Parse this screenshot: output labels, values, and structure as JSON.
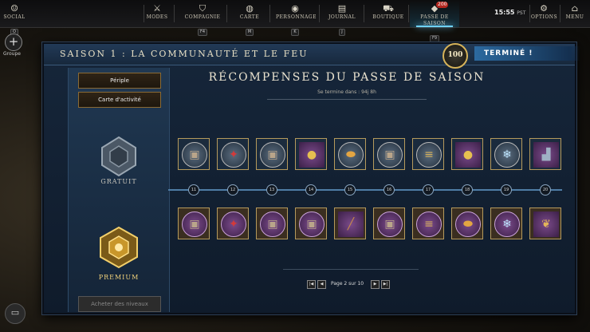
{
  "topbar": {
    "left": {
      "label": "SOCIAL",
      "key": "O",
      "icon": "people-icon"
    },
    "items": [
      {
        "id": "modes",
        "label": "MODES",
        "key": "",
        "icon": "crossed-swords-icon"
      },
      {
        "id": "company",
        "label": "COMPAGNIE",
        "key": "F4",
        "icon": "shield-icon"
      },
      {
        "id": "map",
        "label": "CARTE",
        "key": "M",
        "icon": "globe-icon"
      },
      {
        "id": "character",
        "label": "PERSONNAGE",
        "key": "K",
        "icon": "person-icon"
      },
      {
        "id": "journal",
        "label": "JOURNAL",
        "key": "J",
        "icon": "book-icon"
      },
      {
        "id": "store",
        "label": "BOUTIQUE",
        "key": "",
        "icon": "cart-icon"
      },
      {
        "id": "season",
        "label": "PASSE DE SAISON",
        "key": "F9",
        "icon": "diamond-icon",
        "badge": "200"
      }
    ],
    "clock": "15:55",
    "clock_zone": "PST",
    "options_label": "OPTIONS",
    "menu_label": "MENU"
  },
  "sidebar": {
    "group_label": "Groupe"
  },
  "panel": {
    "title": "SAISON 1 : LA COMMUNAUTÉ ET LE FEU",
    "level": "100",
    "status": "TERMINÉ !",
    "left": {
      "btn_journey": "Périple",
      "btn_activity": "Carte d'activité",
      "free_label": "GRATUIT",
      "premium_label": "PREMIUM",
      "buy_levels": "Acheter des niveaux"
    },
    "rewards_title": "RÉCOMPENSES DU PASSE DE SAISON",
    "ends_in": "Se termine dans : 94j 8h",
    "levels": [
      "11",
      "12",
      "13",
      "14",
      "15",
      "16",
      "17",
      "18",
      "19",
      "20"
    ],
    "free_rewards": [
      {
        "icon": "chest-icon",
        "frame": "orb"
      },
      {
        "icon": "red-gems-icon",
        "frame": "orb"
      },
      {
        "icon": "chest-icon",
        "frame": "orb"
      },
      {
        "icon": "gold-coin-icon",
        "frame": "square"
      },
      {
        "icon": "gold-coins-pile-icon",
        "frame": "orb"
      },
      {
        "icon": "chest-icon",
        "frame": "orb"
      },
      {
        "icon": "coin-stacks-icon",
        "frame": "orb"
      },
      {
        "icon": "gold-coin-icon",
        "frame": "square"
      },
      {
        "icon": "ice-crystals-icon",
        "frame": "orb"
      },
      {
        "icon": "boots-icon",
        "frame": "square"
      }
    ],
    "premium_rewards": [
      {
        "icon": "chest-icon",
        "frame": "orb"
      },
      {
        "icon": "red-gems-icon",
        "frame": "orb"
      },
      {
        "icon": "chest-icon",
        "frame": "orb"
      },
      {
        "icon": "chest-icon",
        "frame": "orb"
      },
      {
        "icon": "musket-icon",
        "frame": "square"
      },
      {
        "icon": "chest-icon",
        "frame": "orb"
      },
      {
        "icon": "coin-stacks-icon",
        "frame": "orb"
      },
      {
        "icon": "gold-coins-pile-icon",
        "frame": "orb"
      },
      {
        "icon": "ice-crystals-icon",
        "frame": "orb"
      },
      {
        "icon": "feathers-icon",
        "frame": "square"
      }
    ],
    "pagination": {
      "text": "Page 2 sur 10"
    }
  }
}
